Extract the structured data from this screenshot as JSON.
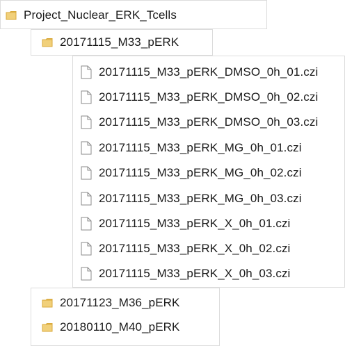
{
  "tree": {
    "root": {
      "label": "Project_Nuclear_ERK_Tcells",
      "icon": "folder-icon"
    },
    "expanded_folder": {
      "label": "20171115_M33_pERK",
      "icon": "folder-icon"
    },
    "files": [
      {
        "label": "20171115_M33_pERK_DMSO_0h_01.czi",
        "icon": "file-icon"
      },
      {
        "label": "20171115_M33_pERK_DMSO_0h_02.czi",
        "icon": "file-icon"
      },
      {
        "label": "20171115_M33_pERK_DMSO_0h_03.czi",
        "icon": "file-icon"
      },
      {
        "label": "20171115_M33_pERK_MG_0h_01.czi",
        "icon": "file-icon"
      },
      {
        "label": "20171115_M33_pERK_MG_0h_02.czi",
        "icon": "file-icon"
      },
      {
        "label": "20171115_M33_pERK_MG_0h_03.czi",
        "icon": "file-icon"
      },
      {
        "label": "20171115_M33_pERK_X_0h_01.czi",
        "icon": "file-icon"
      },
      {
        "label": "20171115_M33_pERK_X_0h_02.czi",
        "icon": "file-icon"
      },
      {
        "label": "20171115_M33_pERK_X_0h_03.czi",
        "icon": "file-icon"
      }
    ],
    "sibling_folders": [
      {
        "label": "20171123_M36_pERK",
        "icon": "folder-icon"
      },
      {
        "label": "20180110_M40_pERK",
        "icon": "folder-icon"
      }
    ]
  },
  "colors": {
    "folder_body": "#e9c46a",
    "folder_tab": "#d9a93a",
    "file_outline": "#8a8a8a",
    "panel_border": "#dcdcdc"
  }
}
